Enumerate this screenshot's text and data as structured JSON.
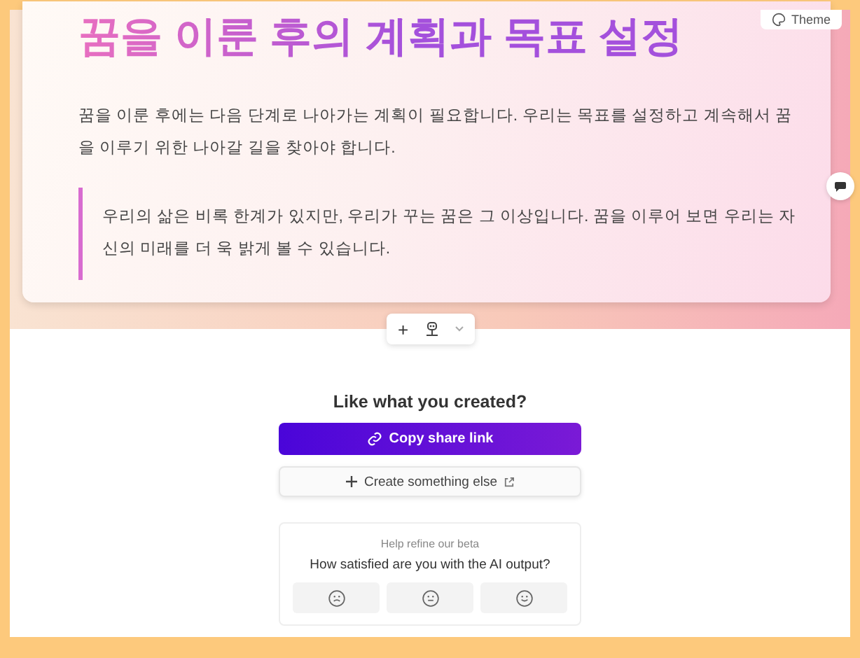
{
  "theme_button": {
    "label": "Theme"
  },
  "document": {
    "title": "꿈을 이룬 후의 계획과 목표 설정",
    "paragraph": "꿈을 이룬 후에는 다음 단계로 나아가는 계획이 필요합니다. 우리는 목표를 설정하고 계속해서 꿈을 이루기 위한 나아갈 길을 찾아야 합니다.",
    "quote": "우리의 삶은 비록 한계가 있지만, 우리가 꾸는 꿈은 그 이상입니다. 꿈을 이루어 보면 우리는 자신의 미래를 더 욱 밝게 볼 수 있습니다."
  },
  "toolbar": {
    "add": "+"
  },
  "share": {
    "heading": "Like what you created?",
    "copy_button": "Copy share link",
    "create_button": "Create something else"
  },
  "feedback": {
    "caption": "Help refine our beta",
    "question": "How satisfied are you with the AI output?",
    "options": [
      {
        "kind": "sad"
      },
      {
        "kind": "neutral"
      },
      {
        "kind": "happy"
      }
    ]
  }
}
